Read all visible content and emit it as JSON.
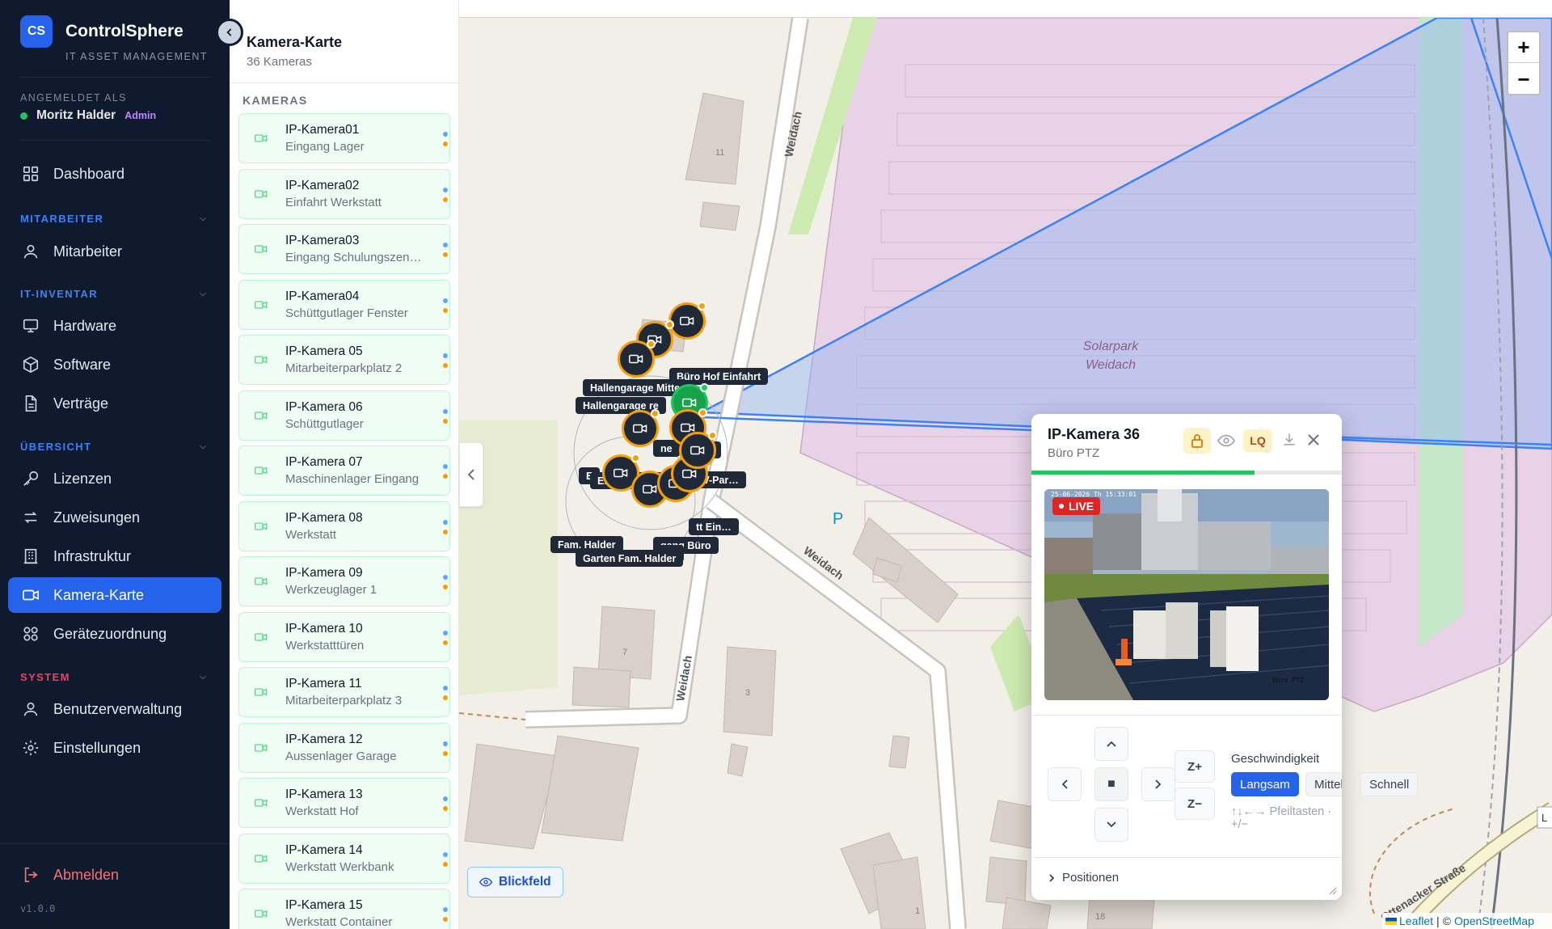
{
  "brand": {
    "logo": "CS",
    "name": "ControlSphere",
    "subtitle": "IT ASSET MANAGEMENT"
  },
  "user": {
    "label": "ANGEMELDET ALS",
    "name": "Moritz Halder",
    "role": "Admin"
  },
  "nav": {
    "dashboard": "Dashboard",
    "sections": {
      "mitarbeiter": "MITARBEITER",
      "inventar": "IT-INVENTAR",
      "uebersicht": "ÜBERSICHT",
      "system": "SYSTEM"
    },
    "items": {
      "mitarbeiter": "Mitarbeiter",
      "hardware": "Hardware",
      "software": "Software",
      "vertraege": "Verträge",
      "lizenzen": "Lizenzen",
      "zuweisungen": "Zuweisungen",
      "infrastruktur": "Infrastruktur",
      "kamera": "Kamera-Karte",
      "geraete": "Gerätezuordnung",
      "benutzer": "Benutzerverwaltung",
      "einstellungen": "Einstellungen"
    },
    "logout": "Abmelden",
    "version": "v1.0.0"
  },
  "camera_list": {
    "title": "Kamera-Karte",
    "count": "36 Kameras",
    "section": "KAMERAS",
    "items": [
      {
        "name": "IP-Kamera01",
        "location": "Eingang Lager"
      },
      {
        "name": "IP-Kamera02",
        "location": "Einfahrt Werkstatt"
      },
      {
        "name": "IP-Kamera03",
        "location": "Eingang Schulungszen…"
      },
      {
        "name": "IP-Kamera04",
        "location": "Schüttgutlager Fenster"
      },
      {
        "name": "IP-Kamera 05",
        "location": "Mitarbeiterparkplatz 2"
      },
      {
        "name": "IP-Kamera 06",
        "location": "Schüttgutlager"
      },
      {
        "name": "IP-Kamera 07",
        "location": "Maschinenlager Eingang"
      },
      {
        "name": "IP-Kamera 08",
        "location": "Werkstatt"
      },
      {
        "name": "IP-Kamera 09",
        "location": "Werkzeuglager 1"
      },
      {
        "name": "IP-Kamera 10",
        "location": "Werkstatttüren"
      },
      {
        "name": "IP-Kamera 11",
        "location": "Mitarbeiterparkplatz 3"
      },
      {
        "name": "IP-Kamera 12",
        "location": "Aussenlager Garage"
      },
      {
        "name": "IP-Kamera 13",
        "location": "Werkstatt Hof"
      },
      {
        "name": "IP-Kamera 14",
        "location": "Werkstatt Werkbank"
      },
      {
        "name": "IP-Kamera 15",
        "location": "Werkstatt Container"
      }
    ]
  },
  "map": {
    "streets": {
      "weidach_1": "Weidach",
      "weidach_2": "Weidach",
      "weidach_3": "Weidach",
      "ottenacker": "Ottenacker Straße"
    },
    "area": {
      "line1": "Solarpark",
      "line2": "Weidach"
    },
    "parking": "P",
    "house_numbers": {
      "n11": "11",
      "n7": "7",
      "n3": "3",
      "n1": "1",
      "n18": "18"
    },
    "edge_label": "L",
    "marker_labels": {
      "buero_hof": "Büro Hof Einfahrt",
      "hallengarage_mitte": "Hallengarage Mitte",
      "hallengarage_re": "Hallengarage re",
      "eingang_garten": "Eingang Garte",
      "pv_par": "PV-Par…",
      "fam_halder": "Fam. Halder",
      "garten_fam_halder": "Garten Fam. Halder",
      "werkstatt_ein": "tt Ein…",
      "eingang_buero": "gang Büro",
      "z_frag": "Z",
      "ne_frag": "ne",
      "el_frag": "E",
      "en_frag": "en"
    },
    "view_toggle": "Blickfeld",
    "zoom_in": "+",
    "zoom_out": "−",
    "attribution": {
      "leaflet": "Leaflet",
      "sep": "|",
      "copy": "©",
      "osm": "OpenStreetMap"
    }
  },
  "popup": {
    "title": "IP-Kamera 36",
    "subtitle": "Büro PTZ",
    "quality": "LQ",
    "progress": 0.72,
    "live": "LIVE",
    "timestamp": "25-06-2026 Th 15:33:01",
    "video_label": "Büro PTZ",
    "ptz": {
      "stop": "■",
      "zoom_in": "Z+",
      "zoom_out": "Z−"
    },
    "speed": {
      "label": "Geschwindigkeit",
      "options": [
        "Langsam",
        "Mittel",
        "Schnell"
      ],
      "selected": "Langsam"
    },
    "hint": "↑↓←→ Pfeiltasten · +/−",
    "positions": "Positionen"
  },
  "colors": {
    "accent": "#2563eb",
    "sidebar": "#0f1a2e",
    "live": "#dc2626",
    "online": "#22c55e",
    "marker_ring": "#f59e0b"
  }
}
